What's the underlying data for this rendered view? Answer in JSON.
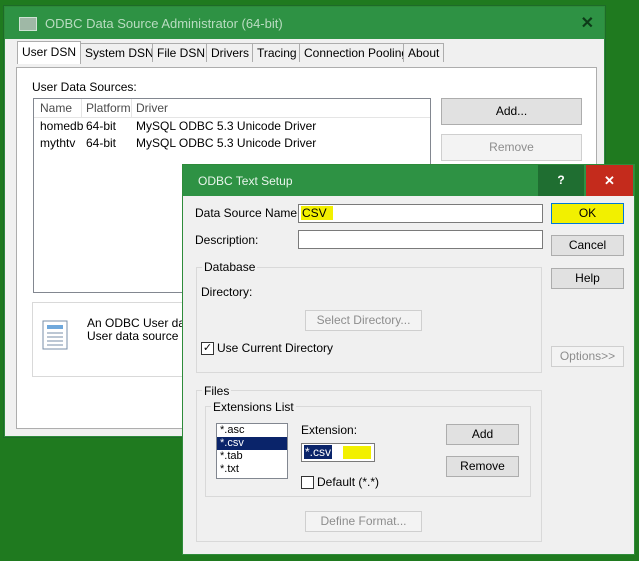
{
  "admin_window": {
    "title": "ODBC Data Source Administrator (64-bit)",
    "close_glyph": "✕",
    "tabs": [
      "User DSN",
      "System DSN",
      "File DSN",
      "Drivers",
      "Tracing",
      "Connection Pooling",
      "About"
    ],
    "active_tab": "User DSN",
    "sources_label": "User Data Sources:",
    "columns": [
      "Name",
      "Platform",
      "Driver"
    ],
    "rows": [
      {
        "name": "homedb",
        "platform": "64-bit",
        "driver": "MySQL ODBC 5.3 Unicode Driver"
      },
      {
        "name": "mythtv",
        "platform": "64-bit",
        "driver": "MySQL ODBC 5.3 Unicode Driver"
      }
    ],
    "add_button": "Add...",
    "remove_button": "Remove",
    "info_line1": "An ODBC User data",
    "info_line2": "User data source is"
  },
  "text_setup": {
    "title": "ODBC Text Setup",
    "help_glyph": "?",
    "close_glyph": "✕",
    "dsn_label": "Data Source Name:",
    "dsn_value": "CSV",
    "description_label": "Description:",
    "description_value": "",
    "ok_button": "OK",
    "cancel_button": "Cancel",
    "help_button": "Help",
    "options_button": "Options>>",
    "database_group": "Database",
    "directory_label": "Directory:",
    "select_directory_button": "Select Directory...",
    "use_current_directory": "Use Current Directory",
    "use_current_checked": true,
    "files_group": "Files",
    "extensions_group": "Extensions List",
    "extensions": [
      "*.asc",
      "*.csv",
      "*.tab",
      "*.txt"
    ],
    "selected_extension": "*.csv",
    "extension_label": "Extension:",
    "extension_value": "*.csv",
    "add_button": "Add",
    "remove_button": "Remove",
    "default_label": "Default (*.*)",
    "default_checked": false,
    "define_format_button": "Define Format...",
    "highlight_color": "#f2f000",
    "title_bar_color": "#2e9244"
  }
}
